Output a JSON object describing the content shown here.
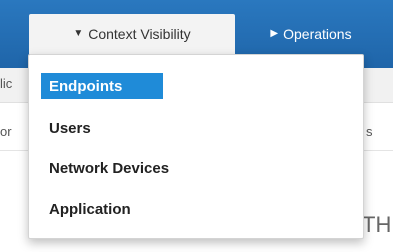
{
  "nav": {
    "context_visibility": {
      "label": "Context Visibility",
      "icon": "caret-down-icon",
      "caret": "▼"
    },
    "operations": {
      "label": "Operations",
      "icon": "caret-right-icon",
      "caret": "▶"
    }
  },
  "background": {
    "fragment_left_top": "lic",
    "fragment_left_mid": "or",
    "fragment_right_mid": "s",
    "fragment_right_bottom": "TH"
  },
  "menu": {
    "items": [
      {
        "label": "Endpoints",
        "active": true
      },
      {
        "label": "Users",
        "active": false
      },
      {
        "label": "Network Devices",
        "active": false
      },
      {
        "label": "Application",
        "active": false
      }
    ]
  },
  "colors": {
    "topbar": "#1f65a9",
    "active_item": "#1f8bd8"
  }
}
